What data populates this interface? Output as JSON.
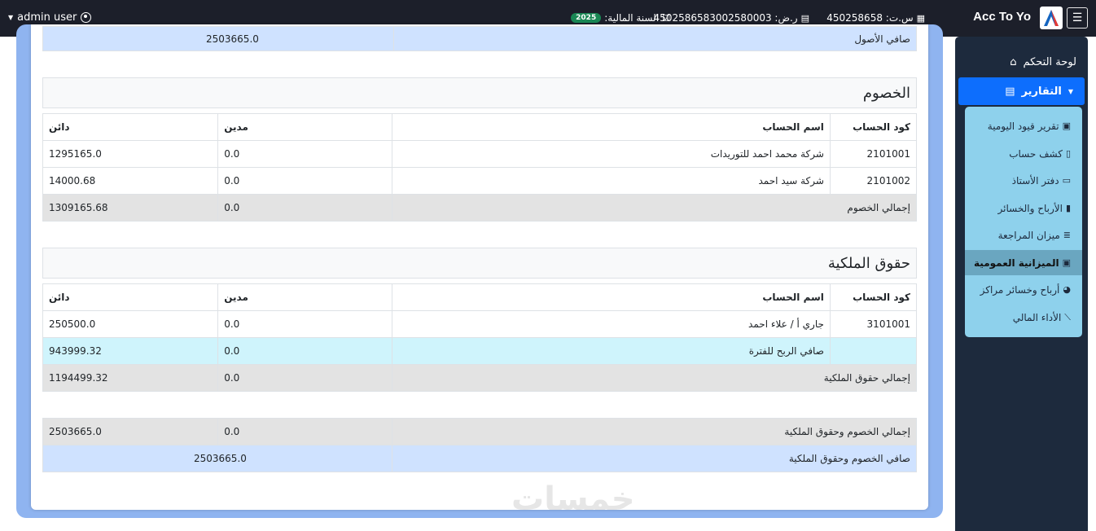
{
  "topbar": {
    "brand": "Acc To Yo",
    "commercial_reg": "س.ت: 450258658",
    "tax_no": "ر.ض: 4502586583002580003",
    "fiscal_year_label": "السنة المالية:",
    "fiscal_year": "2025",
    "user": "admin user"
  },
  "sidebar": {
    "dashboard": "لوحة التحكم",
    "reports": "التقارير",
    "submenu": [
      "تقرير قيود اليومية",
      "كشف حساب",
      "دفتر الأستاذ",
      "الأرباح والخسائر",
      "ميزان المراجعة",
      "الميزانية العمومية",
      "أرباح وخسائر مراكز",
      "الأداء المالي"
    ],
    "active_index": 5
  },
  "assets_net": {
    "label": "صافي الأصول",
    "value": "2503665.0"
  },
  "columns": {
    "code": "كود الحساب",
    "name": "اسم الحساب",
    "debit": "مدين",
    "credit": "دائن"
  },
  "liabilities": {
    "title": "الخصوم",
    "rows": [
      {
        "code": "2101001",
        "name": "شركة محمد احمد للتوريدات",
        "debit": "0.0",
        "credit": "1295165.0"
      },
      {
        "code": "2101002",
        "name": "شركة سيد احمد",
        "debit": "0.0",
        "credit": "14000.68"
      }
    ],
    "total": {
      "label": "إجمالي الخصوم",
      "debit": "0.0",
      "credit": "1309165.68"
    }
  },
  "equity": {
    "title": "حقوق الملكية",
    "rows": [
      {
        "code": "3101001",
        "name": "جاري أ / علاء احمد",
        "debit": "0.0",
        "credit": "250500.0"
      }
    ],
    "net_profit": {
      "label": "صافي الربح للفترة",
      "debit": "0.0",
      "credit": "943999.32"
    },
    "total": {
      "label": "إجمالي حقوق الملكية",
      "debit": "0.0",
      "credit": "1194499.32"
    }
  },
  "grand": {
    "total": {
      "label": "إجمالي الخصوم وحقوق الملكية",
      "debit": "0.0",
      "credit": "2503665.0"
    },
    "net": {
      "label": "صافي الخصوم وحقوق الملكية",
      "value": "2503665.0"
    }
  },
  "watermark": "خمسات"
}
